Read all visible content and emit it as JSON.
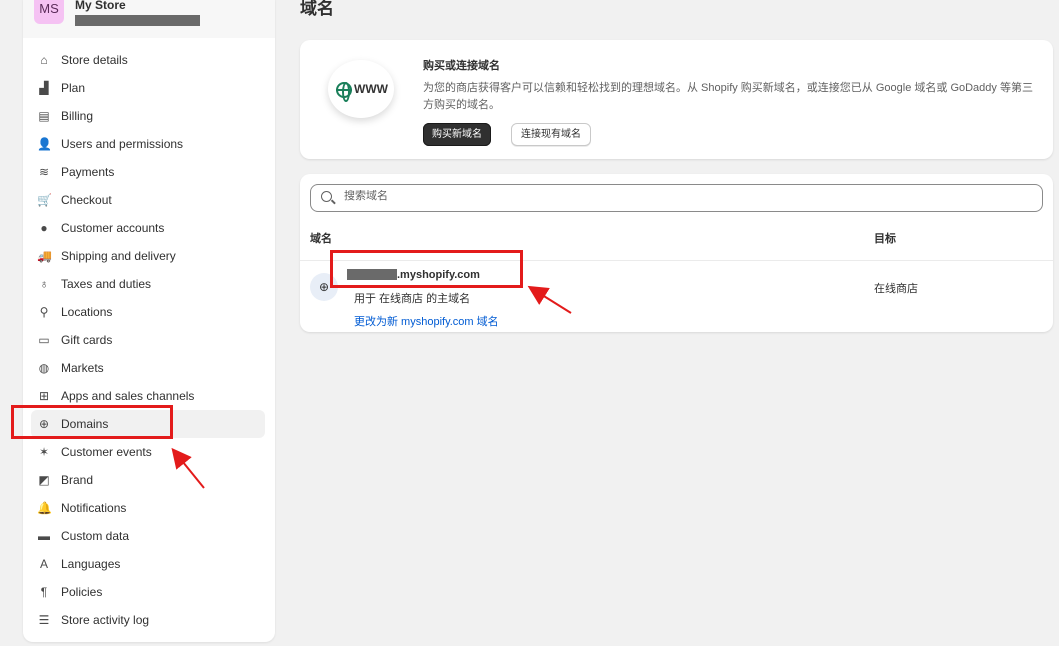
{
  "sidebar": {
    "store": {
      "initials": "MS",
      "name": "My Store"
    },
    "items": [
      {
        "label": "Store details",
        "icon": "storefront-icon",
        "glyph": "⌂"
      },
      {
        "label": "Plan",
        "icon": "plan-chart-icon",
        "glyph": "▟"
      },
      {
        "label": "Billing",
        "icon": "receipt-icon",
        "glyph": "▤"
      },
      {
        "label": "Users and permissions",
        "icon": "user-key-icon",
        "glyph": "👤"
      },
      {
        "label": "Payments",
        "icon": "payments-icon",
        "glyph": "≋"
      },
      {
        "label": "Checkout",
        "icon": "cart-icon",
        "glyph": "🛒"
      },
      {
        "label": "Customer accounts",
        "icon": "person-icon",
        "glyph": "●"
      },
      {
        "label": "Shipping and delivery",
        "icon": "truck-icon",
        "glyph": "🚚"
      },
      {
        "label": "Taxes and duties",
        "icon": "tax-bag-icon",
        "glyph": "♁"
      },
      {
        "label": "Locations",
        "icon": "location-pin-icon",
        "glyph": "⚲"
      },
      {
        "label": "Gift cards",
        "icon": "gift-card-icon",
        "glyph": "▭"
      },
      {
        "label": "Markets",
        "icon": "globe-market-icon",
        "glyph": "◍"
      },
      {
        "label": "Apps and sales channels",
        "icon": "apps-grid-icon",
        "glyph": "⊞"
      },
      {
        "label": "Domains",
        "icon": "globe-icon",
        "glyph": "⊕"
      },
      {
        "label": "Customer events",
        "icon": "cursor-click-icon",
        "glyph": "✶"
      },
      {
        "label": "Brand",
        "icon": "brand-image-icon",
        "glyph": "◩"
      },
      {
        "label": "Notifications",
        "icon": "bell-icon",
        "glyph": "🔔"
      },
      {
        "label": "Custom data",
        "icon": "database-icon",
        "glyph": "▬"
      },
      {
        "label": "Languages",
        "icon": "language-icon",
        "glyph": "A"
      },
      {
        "label": "Policies",
        "icon": "policy-icon",
        "glyph": "¶"
      },
      {
        "label": "Store activity log",
        "icon": "list-icon",
        "glyph": "☰"
      }
    ],
    "active_index": 13
  },
  "main": {
    "title": "域名",
    "promo": {
      "title": "购买或连接域名",
      "description": "为您的商店获得客户可以信赖和轻松找到的理想域名。从 Shopify 购买新域名，或连接您已从 Google 域名或 GoDaddy 等第三方购买的域名。",
      "buy_label": "购买新域名",
      "connect_label": "连接现有域名",
      "image_text": "WWW"
    },
    "domains": {
      "search_placeholder": "搜索域名",
      "col_domain": "域名",
      "col_target": "目标",
      "rows": [
        {
          "name_suffix": ".myshopify.com",
          "subtitle": "用于 在线商店 的主域名",
          "link": "更改为新 myshopify.com 域名",
          "target": "在线商店"
        }
      ]
    }
  },
  "colors": {
    "annotation_red": "#e31b1b",
    "link_blue": "#005bd3",
    "primary_button": "#303030"
  }
}
